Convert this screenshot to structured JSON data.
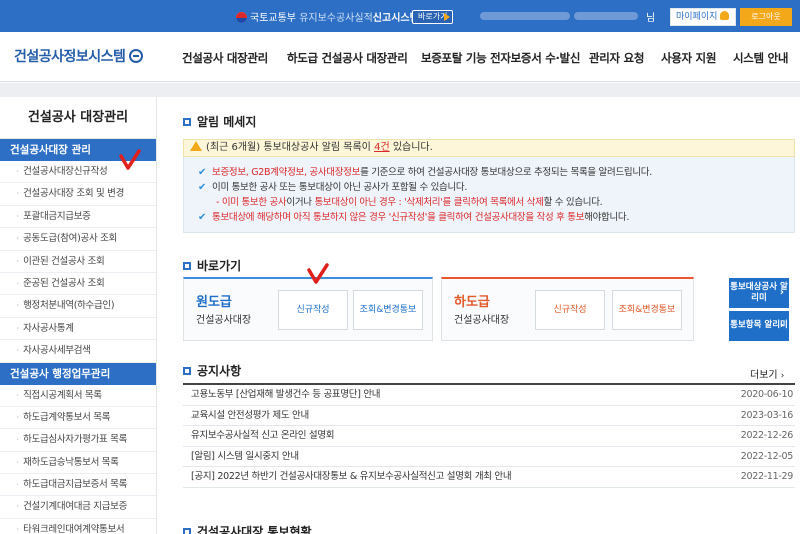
{
  "topbar": {
    "ministry": "국토교통부",
    "service": "유지보수공사실적",
    "system": "신고시스템",
    "shortcut_label": "바로가기",
    "user_suffix": "님",
    "mypage_label": "마이페이지",
    "logout_label": "로그아웃"
  },
  "header": {
    "logo": "건설공사정보시스템",
    "nav": [
      "건설공사 대장관리",
      "하도급 건설공사 대장관리",
      "보증포탈 기능 전자보증서 수·발신",
      "관리자 요청",
      "사용자 지원",
      "시스템 안내"
    ]
  },
  "sidebar": {
    "title": "건설공사 대장관리",
    "section1": "건설공사대장 관리",
    "items1": [
      "건설공사대장신규작성",
      "건설공사대장 조회 및 변경",
      "포괄대금지급보증",
      "공동도급(참여)공사 조회",
      "이관된 건설공사 조회",
      "준공된 건설공사 조회",
      "행정처분내역(하수급인)",
      "자사공사통계",
      "자사공사세부검색"
    ],
    "section2": "건설공사 행정업무관리",
    "items2": [
      "직접시공계획서 목록",
      "하도급계약통보서 목록",
      "하도급심사자가평가표 목록",
      "재하도급승낙통보서 목록",
      "하도급대금지급보증서 목록",
      "건설기계대여대금 지급보증",
      "타워크레인대여계약통보서"
    ]
  },
  "alerts": {
    "title": "알림 메세지",
    "summary_pre": "(최근 6개월) 통보대상공사 알림 목록이",
    "summary_count": "4건",
    "summary_post": "있습니다.",
    "line1_red": "보증정보, G2B계약정보, 공사대장정보",
    "line1_rest": "를 기준으로 하여 건설공사대장 통보대상으로 추정되는 목록을 알려드립니다.",
    "line2": "이미 통보한 공사 또는 통보대상이 아닌 공사가 포함될 수 있습니다.",
    "line3_red": "- 이미 통보한 공사",
    "line3_a": "이거나",
    "line3_red2": "통보대상이 아닌 경우 : '삭제처리'를 클릭하여 목록에서 삭제",
    "line3_b": "할 수 있습니다.",
    "line4_red": "통보대상에 해당하며 아직 통보하지 않은 경우 '신규작성'을 클릭하여 건설공사대장을 작성 후 통보",
    "line4_b": "해야합니다."
  },
  "shortcuts": {
    "title": "바로가기",
    "prime": {
      "name": "원도급",
      "sub": "건설공사대장",
      "btn_new": "신규작성",
      "btn_edit": "조회&변경통보"
    },
    "sub": {
      "name": "하도급",
      "sub": "건설공사대장",
      "btn_new": "신규작성",
      "btn_edit": "조회&변경통보"
    },
    "side_btn1": "통보대상공사 알리미",
    "side_btn2": "통보항목 알리미"
  },
  "notices": {
    "title": "공지사항",
    "more": "더보기",
    "rows": [
      {
        "title": "고용노동부 [산업재해 발생건수 등 공표명단] 안내",
        "date": "2020-06-10"
      },
      {
        "title": "교육시설 안전성평가 제도 안내",
        "date": "2023-03-16"
      },
      {
        "title": "유지보수공사실적 신고 온라인 설명회",
        "date": "2022-12-26"
      },
      {
        "title": "[알림] 시스템 일시중지 안내",
        "date": "2022-12-05"
      },
      {
        "title": "[공지] 2022년 하반기 건설공사대장통보 & 유지보수공사실적신고 설명회 개최 안내",
        "date": "2022-11-29"
      }
    ]
  },
  "bottom_title": "건설공사대장 통보현황",
  "colors": {
    "primary": "#2d6fc4",
    "accent": "#f3a81a",
    "red": "#d8282a",
    "orange": "#e05a2a"
  }
}
